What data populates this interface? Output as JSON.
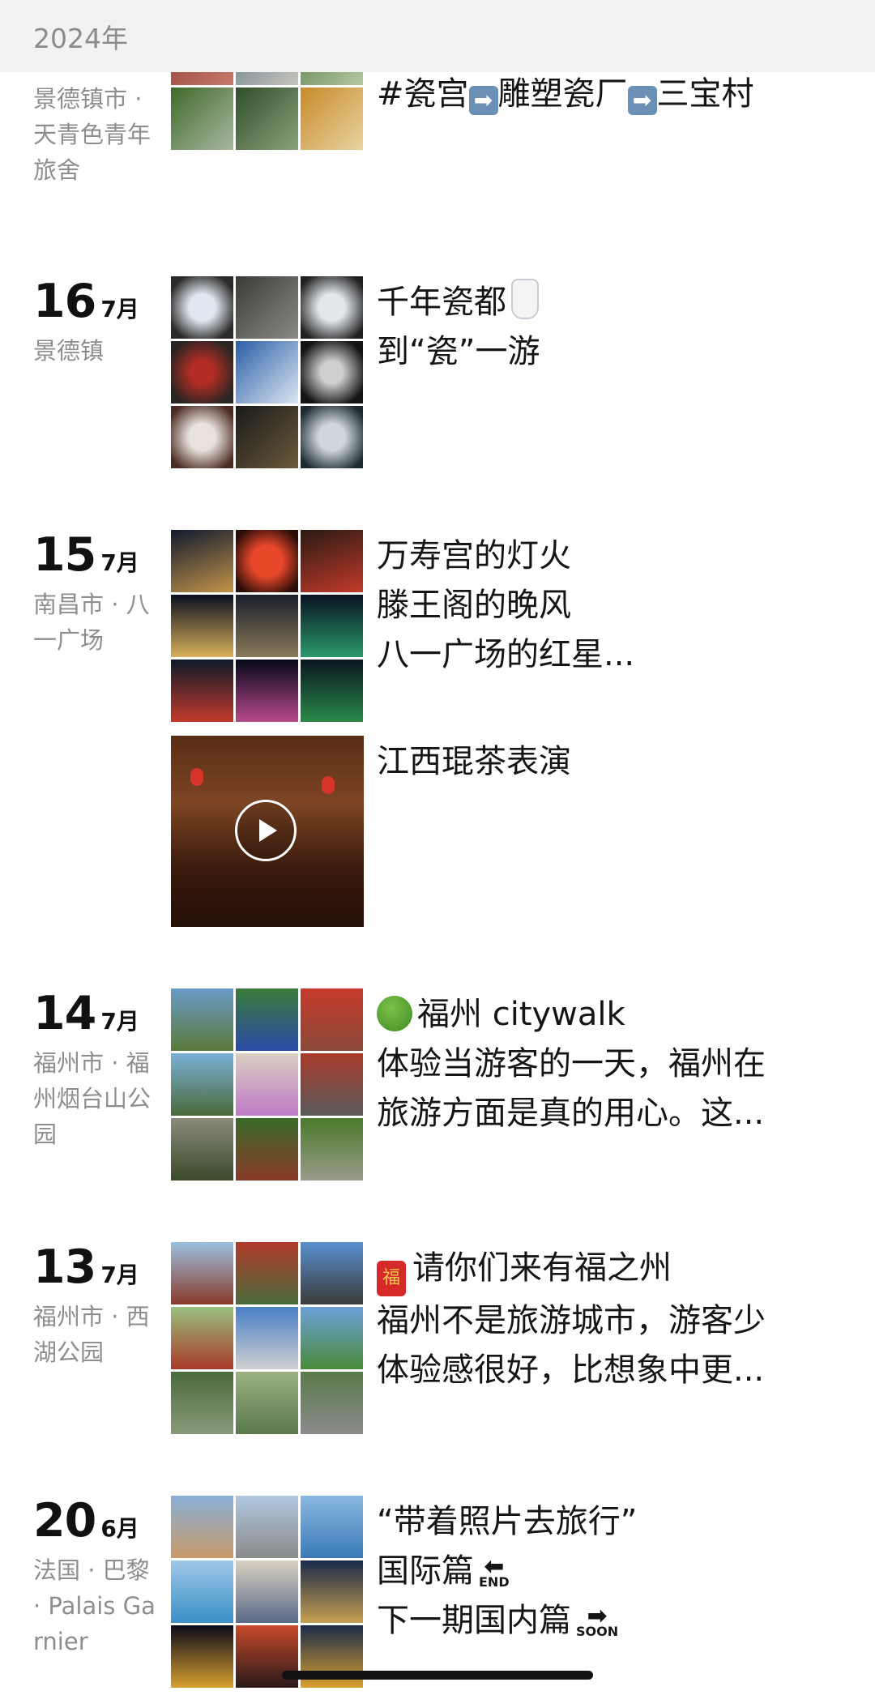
{
  "header": {
    "year": "2024年"
  },
  "colors": {
    "header_bg": "#f2f2f2",
    "muted_text": "#8e8e8e",
    "text": "#151515"
  },
  "entries": [
    {
      "day": "",
      "month": "",
      "place": "景德镇市 · 天青色青年旅舍",
      "lines": [
        "#瓷宫",
        "雕塑瓷厂",
        "三宝村"
      ],
      "arrow_icon": "right-arrow-badge-icon"
    },
    {
      "day": "16",
      "month": "7月",
      "place": "景德镇",
      "lines": [
        "千年瓷都",
        "到“瓷”一游"
      ],
      "emoji": "vase-icon"
    },
    {
      "day": "15",
      "month": "7月",
      "place": "南昌市 · 八一广场",
      "lines": [
        "万寿宫的灯火",
        "滕王阁的晚风",
        "八一广场的红星..."
      ]
    },
    {
      "video_caption": "江西琨茶表演",
      "icon": "play-icon"
    },
    {
      "day": "14",
      "month": "7月",
      "place": "福州市 · 福州烟台山公园",
      "lines": [
        "福州 citywalk",
        "体验当游客的一天，福州在",
        "旅游方面是真的用心。这..."
      ],
      "emoji": "tree-icon"
    },
    {
      "day": "13",
      "month": "7月",
      "place": "福州市 · 西湖公园",
      "lines": [
        "请你们来有福之州",
        "福州不是旅游城市，游客少",
        "体验感很好，比想象中更..."
      ],
      "emoji": "red-envelope-icon",
      "emoji_text": "福"
    },
    {
      "day": "20",
      "month": "6月",
      "place": "法国 · 巴黎 · Palais Garnier",
      "lines": [
        "“带着照片去旅行”",
        "国际篇",
        "下一期国内篇"
      ],
      "tag_end": "END",
      "tag_soon": "SOON"
    }
  ]
}
